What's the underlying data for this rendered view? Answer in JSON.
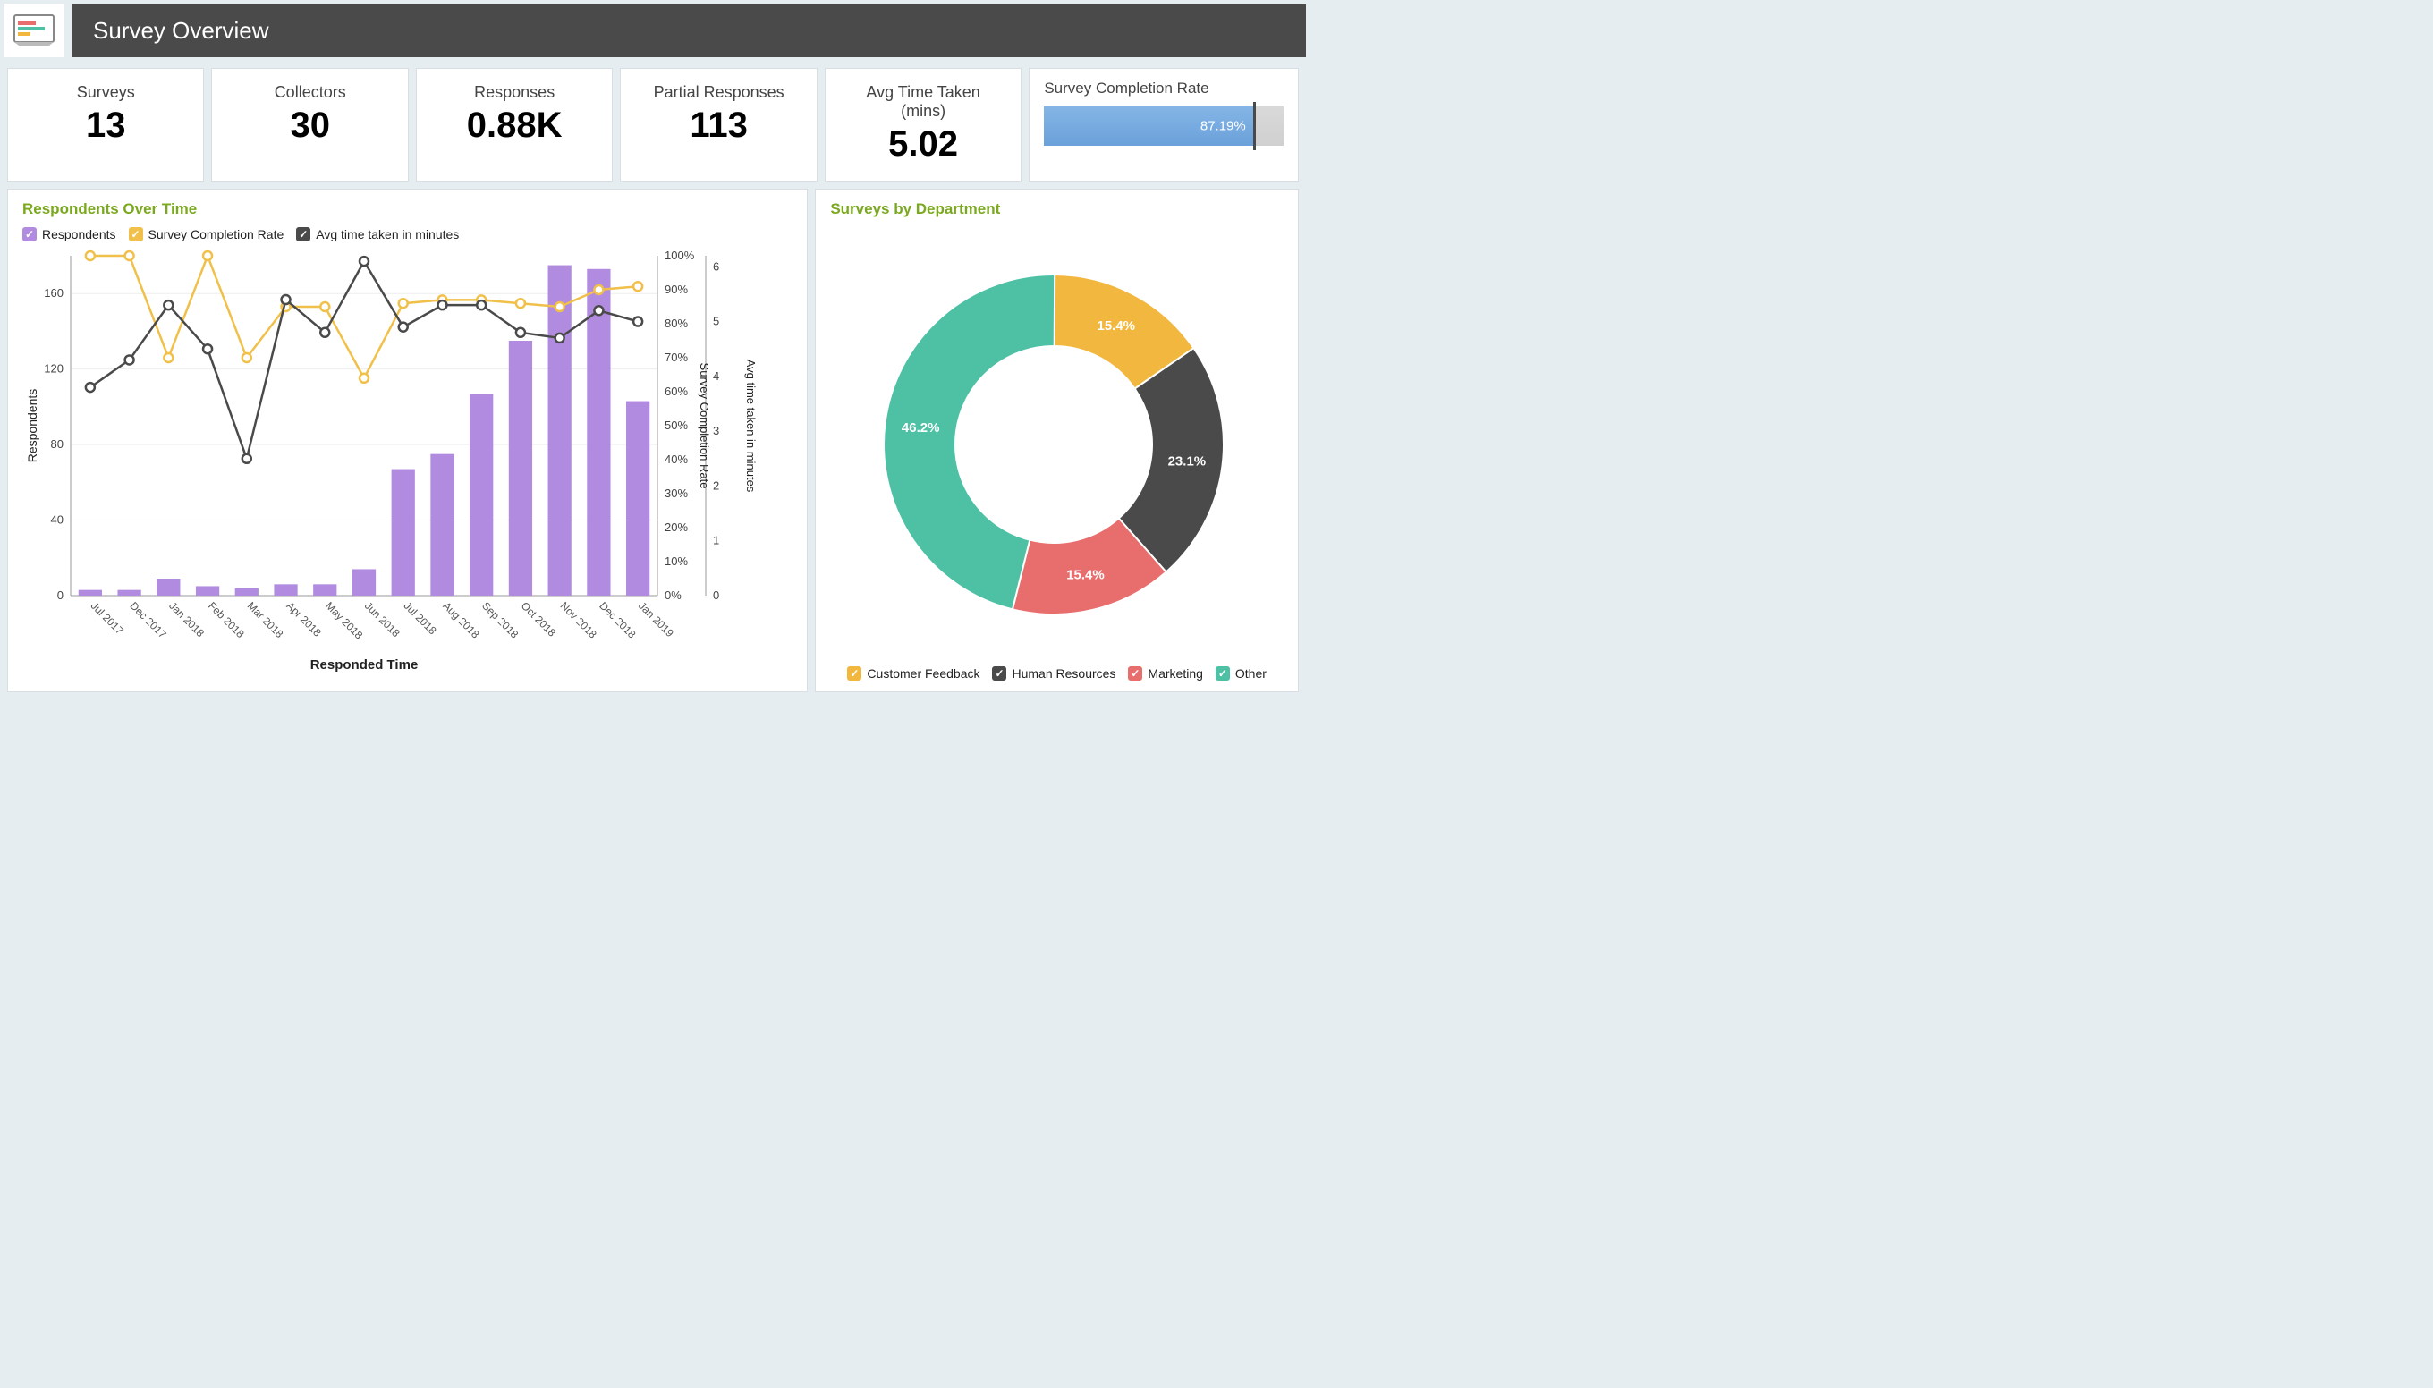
{
  "header": {
    "title": "Survey Overview"
  },
  "kpis": [
    {
      "label": "Surveys",
      "value": "13"
    },
    {
      "label": "Collectors",
      "value": "30"
    },
    {
      "label": "Responses",
      "value": "0.88K"
    },
    {
      "label": "Partial Responses",
      "value": "113"
    },
    {
      "label": "Avg Time Taken (mins)",
      "value": "5.02"
    }
  ],
  "completion": {
    "title": "Survey Completion Rate",
    "value_label": "87.19%",
    "value_pct": 87.19
  },
  "panels": {
    "respondents": {
      "title": "Respondents Over Time",
      "legend": {
        "respondents": "Respondents",
        "scr": "Survey Completion Rate",
        "avg_time": "Avg time taken in minutes"
      },
      "xlabel": "Responded Time"
    },
    "departments": {
      "title": "Surveys by Department",
      "legend": {
        "customer_feedback": "Customer Feedback",
        "human_resources": "Human Resources",
        "marketing": "Marketing",
        "other": "Other"
      }
    }
  },
  "colors": {
    "bar": "#b18be0",
    "scr_line": "#f0c04a",
    "avg_time_line": "#4a4a4a",
    "teal": "#4ec1a5",
    "amber": "#f1b73e",
    "dark": "#4a4a4a",
    "red": "#e86d6d"
  },
  "chart_data": [
    {
      "type": "combo",
      "title": "Respondents Over Time",
      "xlabel": "Responded Time",
      "y_left_label": "Respondents",
      "y_right1_label": "Survey Completion Rate",
      "y_right2_label": "Avg time taken in minutes",
      "categories": [
        "Jul 2017",
        "Dec 2017",
        "Jan 2018",
        "Feb 2018",
        "Mar 2018",
        "Apr 2018",
        "May 2018",
        "Jun 2018",
        "Jul 2018",
        "Aug 2018",
        "Sep 2018",
        "Oct 2018",
        "Nov 2018",
        "Dec 2018",
        "Jan 2019"
      ],
      "y_left_ticks": [
        0,
        40,
        80,
        120,
        160
      ],
      "y_right1_ticks": [
        0,
        10,
        20,
        30,
        40,
        50,
        60,
        70,
        80,
        90,
        100
      ],
      "y_right2_ticks": [
        0,
        1,
        2,
        3,
        4,
        5,
        6
      ],
      "y_left_range": [
        0,
        180
      ],
      "y_right1_range": [
        0,
        100
      ],
      "y_right2_range": [
        0,
        6.2
      ],
      "series": [
        {
          "name": "Respondents",
          "kind": "bar",
          "values": [
            3,
            3,
            9,
            5,
            4,
            6,
            6,
            14,
            67,
            75,
            107,
            135,
            175,
            173,
            103
          ]
        },
        {
          "name": "Survey Completion Rate",
          "kind": "line",
          "axis": "right1",
          "unit": "%",
          "values": [
            100,
            100,
            70,
            100,
            70,
            85,
            85,
            64,
            86,
            87,
            87,
            86,
            85,
            90,
            91
          ]
        },
        {
          "name": "Avg time taken in minutes",
          "kind": "line",
          "axis": "right2",
          "unit": "min",
          "values": [
            3.8,
            4.3,
            5.3,
            4.5,
            2.5,
            5.4,
            4.8,
            6.1,
            4.9,
            5.3,
            5.3,
            4.8,
            4.7,
            5.2,
            5.0
          ]
        }
      ]
    },
    {
      "type": "donut",
      "title": "Surveys by Department",
      "series": [
        {
          "name": "Customer Feedback",
          "value": 15.4,
          "color_key": "amber"
        },
        {
          "name": "Human Resources",
          "value": 23.1,
          "color_key": "dark"
        },
        {
          "name": "Marketing",
          "value": 15.4,
          "color_key": "red"
        },
        {
          "name": "Other",
          "value": 46.2,
          "color_key": "teal"
        }
      ]
    }
  ]
}
